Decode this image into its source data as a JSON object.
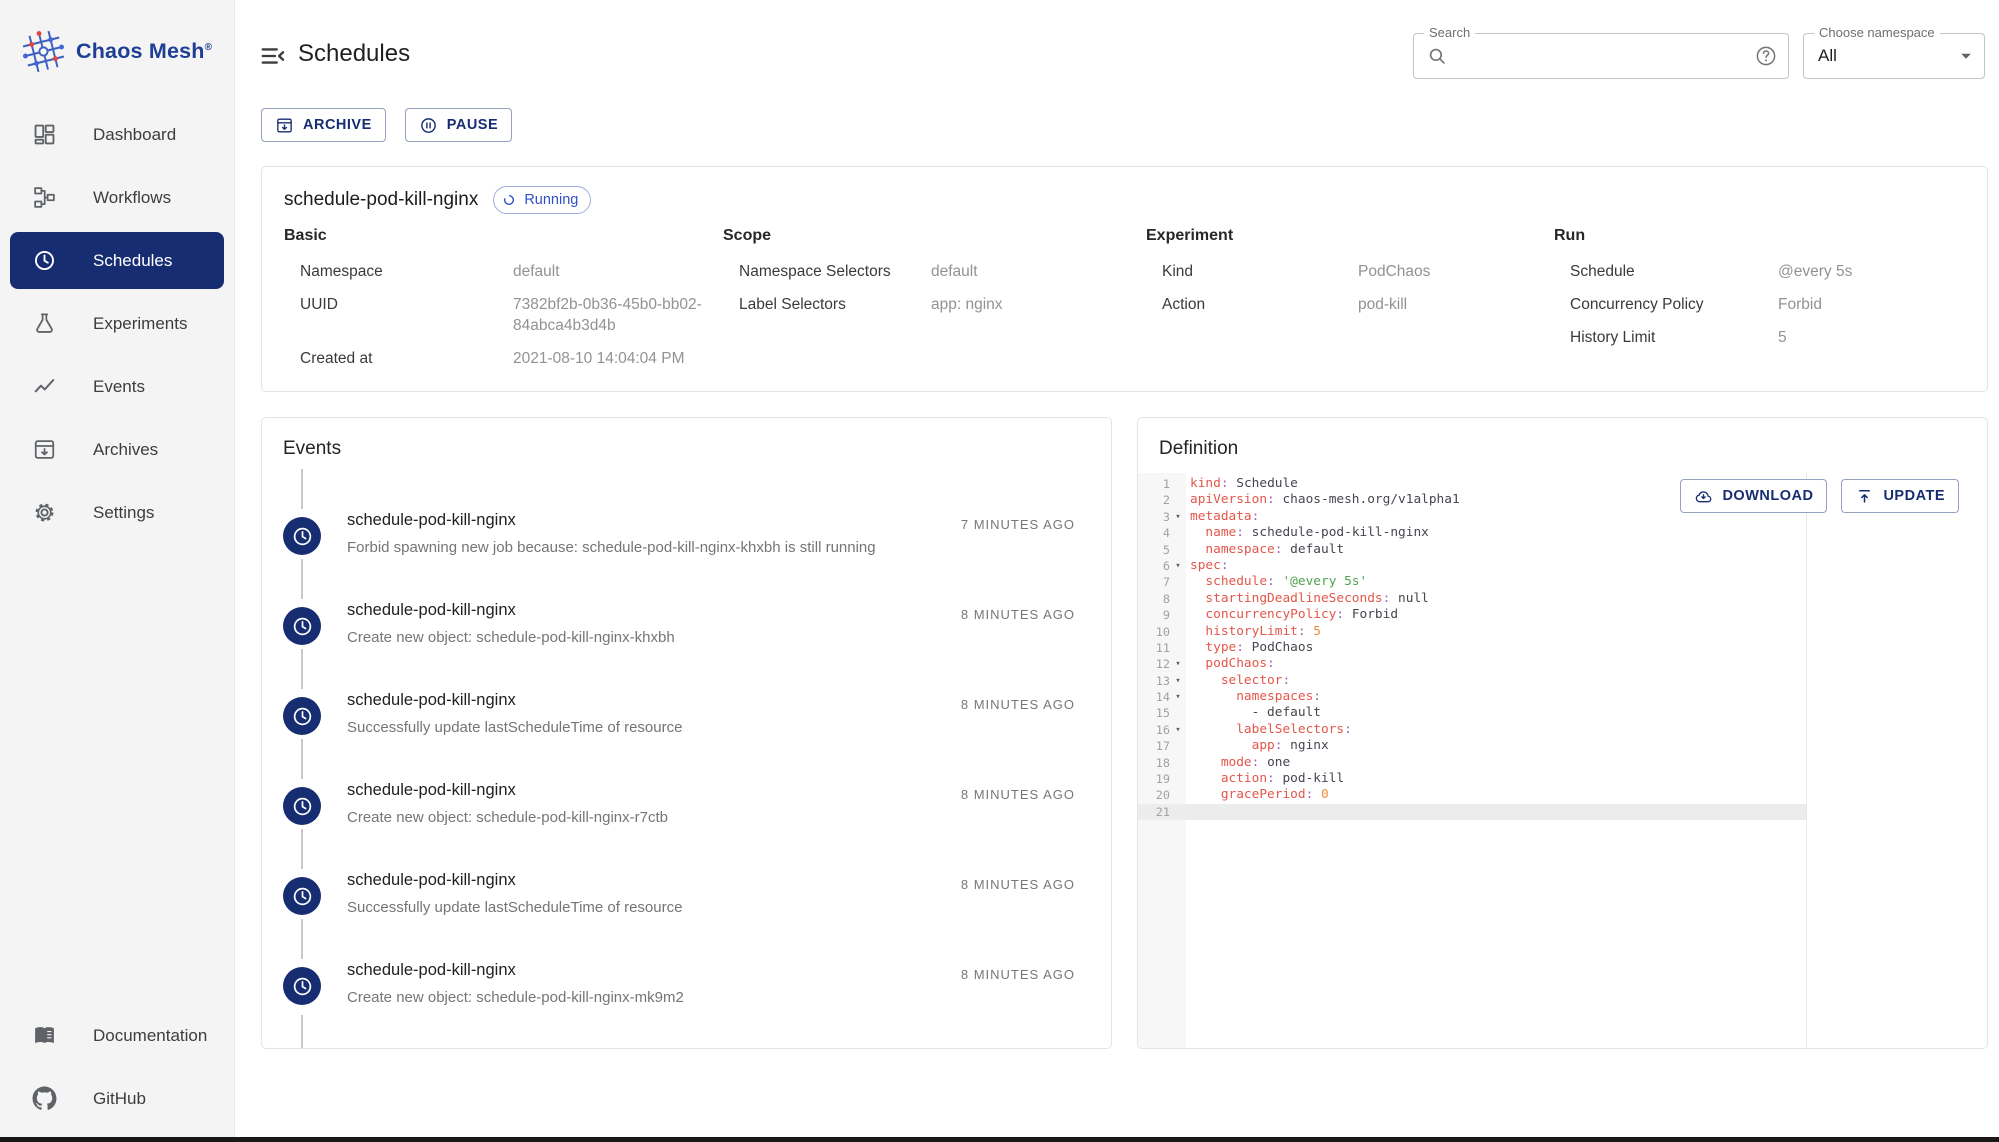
{
  "brand": {
    "name": "Chaos Mesh",
    "registered_mark": "®"
  },
  "header": {
    "title": "Schedules",
    "search": {
      "label": "Search",
      "value": ""
    },
    "namespace_select": {
      "label": "Choose namespace",
      "value": "All"
    }
  },
  "toolbar": {
    "archive_label": "ARCHIVE",
    "pause_label": "PAUSE"
  },
  "sidebar": {
    "items": [
      {
        "label": "Dashboard",
        "icon": "dashboard-icon",
        "active": false
      },
      {
        "label": "Workflows",
        "icon": "workflows-icon",
        "active": false
      },
      {
        "label": "Schedules",
        "icon": "schedules-icon",
        "active": true
      },
      {
        "label": "Experiments",
        "icon": "experiments-icon",
        "active": false
      },
      {
        "label": "Events",
        "icon": "events-icon",
        "active": false
      },
      {
        "label": "Archives",
        "icon": "archives-icon",
        "active": false
      },
      {
        "label": "Settings",
        "icon": "settings-icon",
        "active": false
      }
    ],
    "footer_items": [
      {
        "label": "Documentation",
        "icon": "documentation-icon",
        "active": false
      },
      {
        "label": "GitHub",
        "icon": "github-icon",
        "active": false
      }
    ]
  },
  "schedule": {
    "name": "schedule-pod-kill-nginx",
    "status": "Running",
    "sections": [
      {
        "title": "Basic",
        "rows": [
          {
            "label": "Namespace",
            "value": "default"
          },
          {
            "label": "UUID",
            "value": "7382bf2b-0b36-45b0-bb02-84abca4b3d4b"
          },
          {
            "label": "Created at",
            "value": "2021-08-10 14:04:04 PM"
          }
        ]
      },
      {
        "title": "Scope",
        "rows": [
          {
            "label": "Namespace Selectors",
            "value": "default"
          },
          {
            "label": "Label Selectors",
            "value": "app: nginx"
          }
        ]
      },
      {
        "title": "Experiment",
        "rows": [
          {
            "label": "Kind",
            "value": "PodChaos"
          },
          {
            "label": "Action",
            "value": "pod-kill"
          }
        ]
      },
      {
        "title": "Run",
        "rows": [
          {
            "label": "Schedule",
            "value": "@every 5s"
          },
          {
            "label": "Concurrency Policy",
            "value": "Forbid"
          },
          {
            "label": "History Limit",
            "value": "5"
          }
        ]
      }
    ]
  },
  "events": {
    "title": "Events",
    "items": [
      {
        "name": "schedule-pod-kill-nginx",
        "message": "Forbid spawning new job because: schedule-pod-kill-nginx-khxbh is still running",
        "time": "7 MINUTES AGO"
      },
      {
        "name": "schedule-pod-kill-nginx",
        "message": "Create new object: schedule-pod-kill-nginx-khxbh",
        "time": "8 MINUTES AGO"
      },
      {
        "name": "schedule-pod-kill-nginx",
        "message": "Successfully update lastScheduleTime of resource",
        "time": "8 MINUTES AGO"
      },
      {
        "name": "schedule-pod-kill-nginx",
        "message": "Create new object: schedule-pod-kill-nginx-r7ctb",
        "time": "8 MINUTES AGO"
      },
      {
        "name": "schedule-pod-kill-nginx",
        "message": "Successfully update lastScheduleTime of resource",
        "time": "8 MINUTES AGO"
      },
      {
        "name": "schedule-pod-kill-nginx",
        "message": "Create new object: schedule-pod-kill-nginx-mk9m2",
        "time": "8 MINUTES AGO"
      }
    ]
  },
  "definition": {
    "title": "Definition",
    "download_label": "DOWNLOAD",
    "update_label": "UPDATE",
    "code_lines": [
      {
        "n": 1,
        "fold": false,
        "active": false,
        "tokens": [
          [
            "key",
            "kind"
          ],
          [
            "pun",
            ":"
          ],
          [
            "val",
            " Schedule"
          ]
        ]
      },
      {
        "n": 2,
        "fold": false,
        "active": false,
        "tokens": [
          [
            "key",
            "apiVersion"
          ],
          [
            "pun",
            ":"
          ],
          [
            "val",
            " chaos-mesh.org/v1alpha1"
          ]
        ]
      },
      {
        "n": 3,
        "fold": true,
        "active": false,
        "tokens": [
          [
            "key",
            "metadata"
          ],
          [
            "pun",
            ":"
          ]
        ]
      },
      {
        "n": 4,
        "fold": false,
        "active": false,
        "tokens": [
          [
            "key",
            "  name"
          ],
          [
            "pun",
            ":"
          ],
          [
            "val",
            " schedule-pod-kill-nginx"
          ]
        ]
      },
      {
        "n": 5,
        "fold": false,
        "active": false,
        "tokens": [
          [
            "key",
            "  namespace"
          ],
          [
            "pun",
            ":"
          ],
          [
            "val",
            " default"
          ]
        ]
      },
      {
        "n": 6,
        "fold": true,
        "active": false,
        "tokens": [
          [
            "key",
            "spec"
          ],
          [
            "pun",
            ":"
          ]
        ]
      },
      {
        "n": 7,
        "fold": false,
        "active": false,
        "tokens": [
          [
            "key",
            "  schedule"
          ],
          [
            "pun",
            ":"
          ],
          [
            "str",
            " '@every 5s'"
          ]
        ]
      },
      {
        "n": 8,
        "fold": false,
        "active": false,
        "tokens": [
          [
            "key",
            "  startingDeadlineSeconds"
          ],
          [
            "pun",
            ":"
          ],
          [
            "val",
            " null"
          ]
        ]
      },
      {
        "n": 9,
        "fold": false,
        "active": false,
        "tokens": [
          [
            "key",
            "  concurrencyPolicy"
          ],
          [
            "pun",
            ":"
          ],
          [
            "val",
            " Forbid"
          ]
        ]
      },
      {
        "n": 10,
        "fold": false,
        "active": false,
        "tokens": [
          [
            "key",
            "  historyLimit"
          ],
          [
            "pun",
            ":"
          ],
          [
            "num",
            " 5"
          ]
        ]
      },
      {
        "n": 11,
        "fold": false,
        "active": false,
        "tokens": [
          [
            "key",
            "  type"
          ],
          [
            "pun",
            ":"
          ],
          [
            "val",
            " PodChaos"
          ]
        ]
      },
      {
        "n": 12,
        "fold": true,
        "active": false,
        "tokens": [
          [
            "key",
            "  podChaos"
          ],
          [
            "pun",
            ":"
          ]
        ]
      },
      {
        "n": 13,
        "fold": true,
        "active": false,
        "tokens": [
          [
            "key",
            "    selector"
          ],
          [
            "pun",
            ":"
          ]
        ]
      },
      {
        "n": 14,
        "fold": true,
        "active": false,
        "tokens": [
          [
            "key",
            "      namespaces"
          ],
          [
            "pun",
            ":"
          ]
        ]
      },
      {
        "n": 15,
        "fold": false,
        "active": false,
        "tokens": [
          [
            "val",
            "        - default"
          ]
        ]
      },
      {
        "n": 16,
        "fold": true,
        "active": false,
        "tokens": [
          [
            "key",
            "      labelSelectors"
          ],
          [
            "pun",
            ":"
          ]
        ]
      },
      {
        "n": 17,
        "fold": false,
        "active": false,
        "tokens": [
          [
            "key",
            "        app"
          ],
          [
            "pun",
            ":"
          ],
          [
            "val",
            " nginx"
          ]
        ]
      },
      {
        "n": 18,
        "fold": false,
        "active": false,
        "tokens": [
          [
            "key",
            "    mode"
          ],
          [
            "pun",
            ":"
          ],
          [
            "val",
            " one"
          ]
        ]
      },
      {
        "n": 19,
        "fold": false,
        "active": false,
        "tokens": [
          [
            "key",
            "    action"
          ],
          [
            "pun",
            ":"
          ],
          [
            "val",
            " pod-kill"
          ]
        ]
      },
      {
        "n": 20,
        "fold": false,
        "active": false,
        "tokens": [
          [
            "key",
            "    gracePeriod"
          ],
          [
            "pun",
            ":"
          ],
          [
            "num",
            " 0"
          ]
        ]
      },
      {
        "n": 21,
        "fold": false,
        "active": true,
        "tokens": []
      }
    ]
  },
  "colors": {
    "brand_primary": "#172d72",
    "status_running": "#3050c8",
    "code_key": "#e45649",
    "code_string": "#50a14f",
    "code_number": "#f08c36",
    "code_punctuation": "#a05fb5",
    "code_value": "#44474f"
  }
}
